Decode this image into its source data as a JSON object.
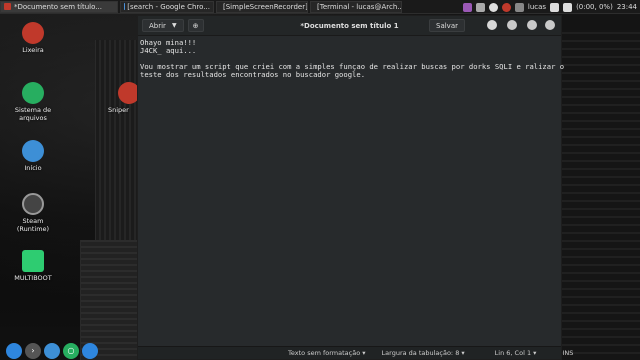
{
  "taskbar": {
    "tasks": [
      {
        "label": "*Documento sem título...",
        "icon": "text-editor-icon",
        "color": "#c0392b"
      },
      {
        "label": "[search - Google Chro...",
        "icon": "chrome-icon",
        "color": "#4a90d9"
      },
      {
        "label": "[SimpleScreenRecorder]",
        "icon": "recorder-icon",
        "color": "#7f8c8d"
      },
      {
        "label": "[Terminal - lucas@Arch...",
        "icon": "terminal-icon",
        "color": "#555555"
      }
    ],
    "tray": {
      "user": "lucas",
      "battery": "(0:00, 0%)",
      "clock": "23:44"
    }
  },
  "desktop_icons": [
    {
      "label": "Lixeira",
      "icon": "trash-icon",
      "color": "#c0392b"
    },
    {
      "label": "Sistema de arquivos",
      "icon": "drive-icon",
      "color": "#27ae60"
    },
    {
      "label": "Início",
      "icon": "home-folder-icon",
      "color": "#3d8fd6"
    },
    {
      "label": "Steam (Runtime)",
      "icon": "steam-icon",
      "color": "#444444"
    },
    {
      "label": "MULTIBOOT",
      "icon": "usb-drive-icon",
      "color": "#2ecc71"
    },
    {
      "label": "Sniper",
      "icon": "sniper-icon",
      "color": "#c0392b"
    }
  ],
  "editor": {
    "open_label": "Abrir",
    "title": "*Documento sem título 1",
    "save_label": "Salvar",
    "content": "Ohayo mina!!!\nJ4CK_ aqui...\n\nVou mostrar um script que criei com a simples funçao de realizar buscas por dorks SQLI e ralizar o\nteste dos resultados encontrados no buscador google.",
    "status": {
      "syntax": "Texto sem formatação",
      "tab_width": "Largura da tabulação: 8",
      "position": "Lin 6, Col 1",
      "mode": "INS"
    }
  },
  "dock": [
    {
      "icon": "globe-icon",
      "color": "#2e86de"
    },
    {
      "icon": "terminal-icon",
      "color": "#555555"
    },
    {
      "icon": "files-icon",
      "color": "#3d8fd6"
    },
    {
      "icon": "search-icon",
      "color": "#27ae60"
    },
    {
      "icon": "browser-icon",
      "color": "#2e86de"
    }
  ]
}
